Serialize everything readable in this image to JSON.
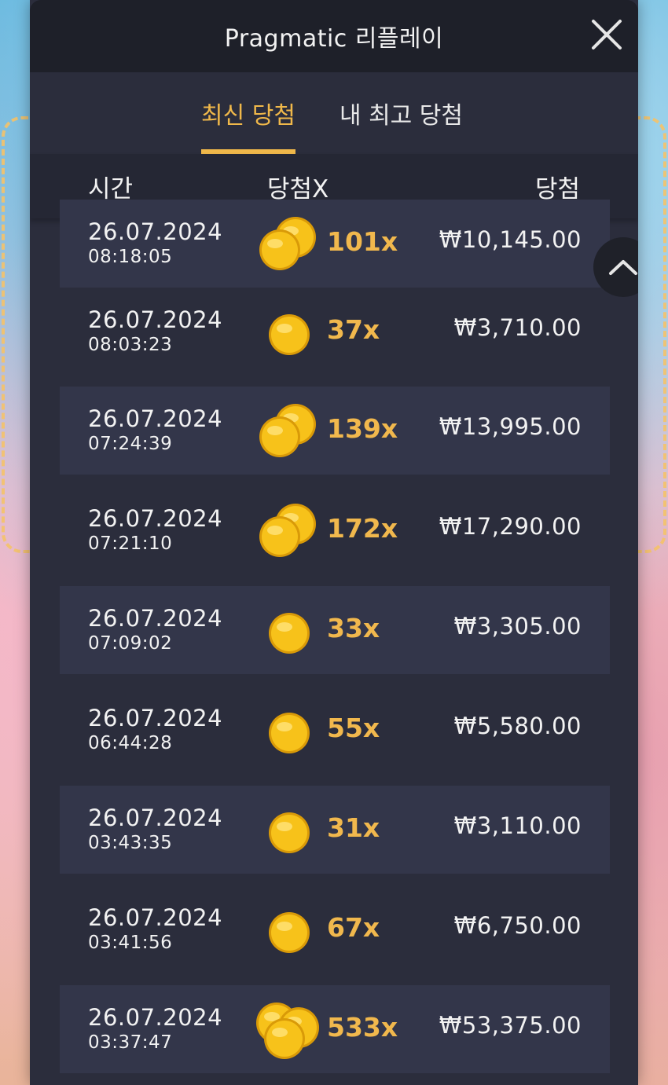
{
  "header": {
    "title": "Pragmatic 리플레이"
  },
  "tabs": [
    {
      "label": "최신 당첨",
      "active": true
    },
    {
      "label": "내 최고 당첨",
      "active": false
    }
  ],
  "columns": {
    "time": "시간",
    "multiplier": "당첨X",
    "win": "당첨"
  },
  "rows": [
    {
      "date": "26.07.2024",
      "time": "08:18:05",
      "multiplier": "101x",
      "amount": "₩10,145.00",
      "coins": "double-coin-icon"
    },
    {
      "date": "26.07.2024",
      "time": "08:03:23",
      "multiplier": "37x",
      "amount": "₩3,710.00",
      "coins": "single-coin-icon"
    },
    {
      "date": "26.07.2024",
      "time": "07:24:39",
      "multiplier": "139x",
      "amount": "₩13,995.00",
      "coins": "double-coin-icon"
    },
    {
      "date": "26.07.2024",
      "time": "07:21:10",
      "multiplier": "172x",
      "amount": "₩17,290.00",
      "coins": "double-coin-icon"
    },
    {
      "date": "26.07.2024",
      "time": "07:09:02",
      "multiplier": "33x",
      "amount": "₩3,305.00",
      "coins": "single-coin-icon"
    },
    {
      "date": "26.07.2024",
      "time": "06:44:28",
      "multiplier": "55x",
      "amount": "₩5,580.00",
      "coins": "single-coin-icon"
    },
    {
      "date": "26.07.2024",
      "time": "03:43:35",
      "multiplier": "31x",
      "amount": "₩3,110.00",
      "coins": "single-coin-icon"
    },
    {
      "date": "26.07.2024",
      "time": "03:41:56",
      "multiplier": "67x",
      "amount": "₩6,750.00",
      "coins": "single-coin-icon"
    },
    {
      "date": "26.07.2024",
      "time": "03:37:47",
      "multiplier": "533x",
      "amount": "₩53,375.00",
      "coins": "triple-coin-icon"
    }
  ],
  "colors": {
    "accent": "#f0b84a",
    "panel": "#2b2d3c",
    "header": "#1e2029",
    "row_alt": "#33364a"
  }
}
